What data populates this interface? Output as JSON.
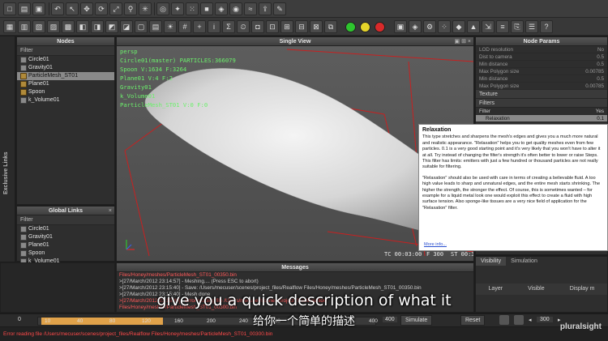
{
  "panels": {
    "nodes": {
      "title": "Nodes",
      "filter": "Filter",
      "items": [
        {
          "label": "Circle01",
          "icon": "daemon-icon"
        },
        {
          "label": "Gravity01",
          "icon": "daemon-icon"
        },
        {
          "label": "ParticleMesh_ST01",
          "icon": "mesh-icon",
          "selected": true
        },
        {
          "label": "Plane01",
          "icon": "object-icon"
        },
        {
          "label": "Spoon",
          "icon": "object-icon"
        },
        {
          "label": "k_Volume01",
          "icon": "daemon-icon"
        }
      ]
    },
    "global_links": {
      "title": "Global Links",
      "filter": "Filter",
      "items": [
        "Circle01",
        "Gravity01",
        "Plane01",
        "Spoon",
        "k_Volume01"
      ]
    },
    "side_label": "Exclusive Links",
    "viewport": {
      "title": "Single View",
      "hud": [
        "persp",
        "Circle01(master) PARTICLES:366079",
        "Spoon V:1634 F:3264",
        "Plane01 V:4 F:2",
        "Gravity01",
        "k_Volume01",
        "ParticleMesh_ST01 V:0 F:0"
      ],
      "timecode": "TC 00:03:00",
      "frame": "F 300",
      "stats": "ST 00:39:16"
    },
    "messages": {
      "title": "Messages",
      "lines": [
        {
          "text": "Files/Honey/meshes/ParticleMesh_ST01_00350.bin",
          "color": "red"
        },
        {
          "text": ">[27/March/2012 23:14:57] - Meshing.... (Press ESC to abort)",
          "color": "white"
        },
        {
          "text": ">[27/March/2012 23:15:40] - Save: /Users/mecuser/scenes/project_files/Realflow Files/Honey/meshes/ParticleMesh_ST01_00350.bin",
          "color": "white"
        },
        {
          "text": ">[27/March/2012 23:15:40] - Mesh done",
          "color": "white"
        },
        {
          "text": ">[27/March/2012 23:15:40] - Error reading file /Users/mecuser/scenes/project_files/Realflow",
          "color": "red"
        },
        {
          "text": "Files/Honey/meshes/ParticleMesh_ST01_00300.bin",
          "color": "red"
        }
      ]
    },
    "node_params": {
      "title": "Node Params",
      "rows": [
        {
          "label": "LOD resolution",
          "value": "No"
        },
        {
          "label": "Dist to camera",
          "value": "0.5"
        },
        {
          "label": "Min distance",
          "value": "0.5"
        },
        {
          "label": "Max Polygon size",
          "value": "0.00785"
        },
        {
          "label": "Min distance",
          "value": "0.5"
        },
        {
          "label": "Max Polygon size",
          "value": "0.00785"
        }
      ],
      "texture": "Texture",
      "filters": "Filters",
      "filter_header": {
        "label": "Filter",
        "value": "Yes"
      },
      "filter_row": {
        "label": "Relaxation",
        "value": "0.1"
      }
    },
    "layers": {
      "tabs": [
        "Visibility",
        "Simulation"
      ],
      "columns": [
        "Layer",
        "Visible",
        "Display m"
      ]
    }
  },
  "tooltip": {
    "title": "Relaxation",
    "paragraphs": [
      "This type stretches and sharpens the mesh's edges and gives you a much more natural and realistic appearance. \"Relaxation\" helps you to get quality meshes even from few particles. 0.1 is a very good starting point and it's very likely that you won't have to alter it at all. Try instead of changing the filter's strength it's often better to lower or raise Steps. This filter has limits: emitters with just a few hundred or thousand particles are not really suitable for filtering.",
      "\"Relaxation\" should also be used with care in terms of creating a believable fluid. A too high value leads to sharp and unnatural edges, and the entire mesh starts shrinking. The higher the strength, the stronger the effect. Of course, this is sometimes wanted – for example for a liquid metal look one would exploit this effect to create a fluid with high surface tension. Also sponge-like tissues are a very nice field of application for the \"Relaxation\" filter."
    ],
    "more": "More info..."
  },
  "timeline": {
    "start": "0",
    "labels": [
      "10",
      "40",
      "80",
      "120",
      "160",
      "200",
      "240",
      "280",
      "320",
      "360",
      "400"
    ],
    "end_field": "400",
    "simulate": "Simulate",
    "reset": "Reset",
    "frame_field": "300"
  },
  "status": "Error reading file /Users/mecuser/scenes/project_files/Realflow Files/Honey/meshes/ParticleMesh_ST01_00300.bin",
  "subtitle": {
    "en": "give you a quick description of what it",
    "zh": "给你一个简单的描述"
  },
  "watermark": "pluralsight",
  "colors": {
    "hud_green": "#6cf06c",
    "error_red": "#ff4a4a",
    "tooltip_bg": "#ffffff"
  }
}
